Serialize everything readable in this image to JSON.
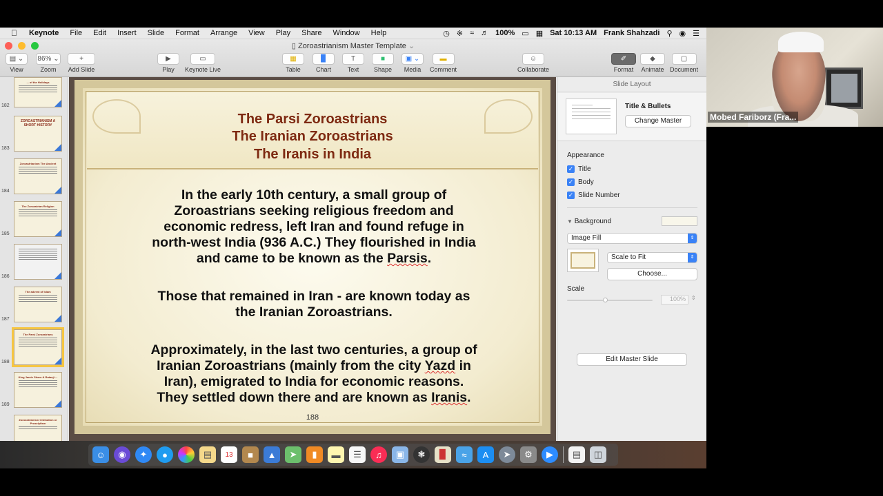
{
  "menubar": {
    "app": "Keynote",
    "items": [
      "File",
      "Edit",
      "Insert",
      "Slide",
      "Format",
      "Arrange",
      "View",
      "Play",
      "Share",
      "Window",
      "Help"
    ],
    "battery": "100%",
    "clock": "Sat 10:13 AM",
    "user": "Frank Shahzadi"
  },
  "window": {
    "title": "Zoroastrianism Master Template"
  },
  "toolbar": {
    "view": "View",
    "zoom_value": "86%",
    "zoom": "Zoom",
    "add_slide": "Add Slide",
    "play": "Play",
    "keynote_live": "Keynote Live",
    "table": "Table",
    "chart": "Chart",
    "text": "Text",
    "shape": "Shape",
    "media": "Media",
    "comment": "Comment",
    "collaborate": "Collaborate",
    "format": "Format",
    "animate": "Animate",
    "document": "Document"
  },
  "navigator": {
    "slides": [
      {
        "num": "182",
        "title": "... of the Holidays"
      },
      {
        "num": "183",
        "title": "ZOROASTRIANISM A SHORT HISTORY"
      },
      {
        "num": "184",
        "title": "Zoroastrianism The Ancient"
      },
      {
        "num": "185",
        "title": "The Zoroastrian Religion"
      },
      {
        "num": "186",
        "title": ""
      },
      {
        "num": "187",
        "title": "The advent of Islam"
      },
      {
        "num": "188",
        "title": "The Parsi Zoroastrians"
      },
      {
        "num": "189",
        "title": "King Jamie Sharo & Ratanji ..."
      },
      {
        "num": "",
        "title": "Zoroastrianism Ordination or Proselytism"
      }
    ]
  },
  "slide": {
    "title_lines": [
      "The Parsi Zoroastrians",
      "The Iranian Zoroastrians",
      "The Iranis in India"
    ],
    "para1_lines": [
      "In the early 10th century, a small group of",
      "Zoroastrians seeking religious freedom and",
      "economic redress, left Iran and found refuge in",
      "north-west India (936 A.C.) They flourished in India",
      "and came to be known as the"
    ],
    "para1_word": "Parsis",
    "para1_end": ".",
    "para2_lines": [
      "Those that remained in Iran - are known today as",
      "the Iranian Zoroastrians."
    ],
    "para3_line1": "Approximately, in the last two centuries, a group of",
    "para3_line2a": "Iranian Zoroastrians (mainly from the city",
    "para3_word1": "Yazd",
    "para3_line2b": "in",
    "para3_line3": "Iran), emigrated to India for economic reasons.",
    "para3_line4a": "They settled down there and are known as",
    "para3_word2": "Iranis",
    "para3_end": ".",
    "number": "188"
  },
  "inspector": {
    "header": "Slide Layout",
    "layout_name": "Title & Bullets",
    "change_master": "Change Master",
    "appearance": "Appearance",
    "checks": [
      "Title",
      "Body",
      "Slide Number"
    ],
    "background": "Background",
    "fill_type": "Image Fill",
    "scale_mode": "Scale to Fit",
    "choose": "Choose...",
    "scale": "Scale",
    "scale_value": "100%",
    "edit_master": "Edit Master Slide"
  },
  "webcam": {
    "name": "Mobed Fariborz (Fra..."
  },
  "colors": {
    "accent": "#3a82f6",
    "slide_title": "#7e2a12",
    "selection": "#f5c542"
  }
}
